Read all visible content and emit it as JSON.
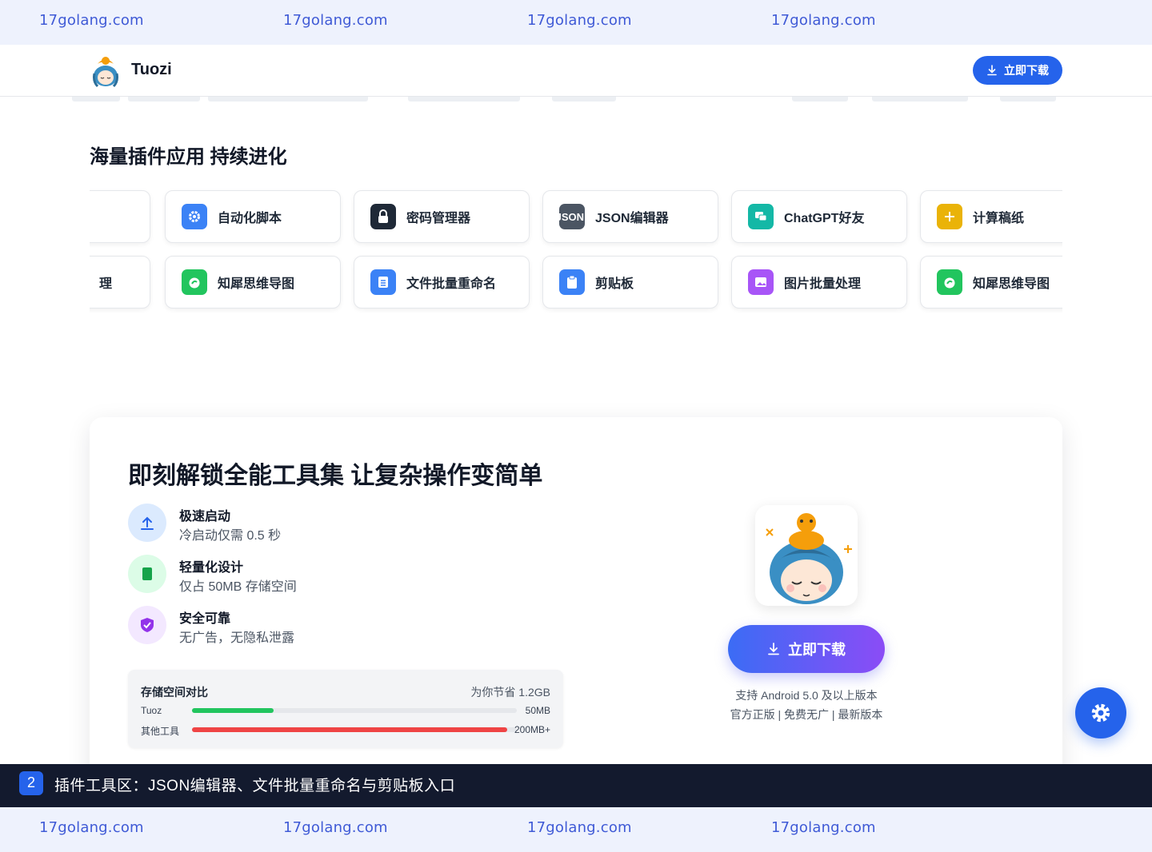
{
  "watermark": {
    "text": "17golang.com"
  },
  "header": {
    "brand": "Tuozi",
    "download_label": "立即下载"
  },
  "plugins": {
    "title": "海量插件应用 持续进化",
    "row1": [
      {
        "label": "",
        "icon": "blank-icon",
        "color": "#ffffff"
      },
      {
        "label": "自动化脚本",
        "icon": "gear-icon",
        "color": "#3b82f6"
      },
      {
        "label": "密码管理器",
        "icon": "lock-icon",
        "color": "#1f2937"
      },
      {
        "label": "JSON编辑器",
        "icon": "json-icon",
        "icon_text": "JSON",
        "color": "#4b5563"
      },
      {
        "label": "ChatGPT好友",
        "icon": "chat-icon",
        "color": "#14b8a6"
      },
      {
        "label": "计算稿纸",
        "icon": "plus-icon",
        "color": "#eab308"
      }
    ],
    "row2": [
      {
        "label": "理",
        "icon": "blank-icon",
        "color": "#ffffff"
      },
      {
        "label": "知犀思维导图",
        "icon": "mindmap-icon",
        "color": "#22c55e"
      },
      {
        "label": "文件批量重命名",
        "icon": "file-list-icon",
        "color": "#3b82f6"
      },
      {
        "label": "剪贴板",
        "icon": "clipboard-icon",
        "color": "#3b82f6"
      },
      {
        "label": "图片批量处理",
        "icon": "image-icon",
        "color": "#a855f7"
      },
      {
        "label": "知犀思维导图",
        "icon": "mindmap-icon",
        "color": "#22c55e"
      }
    ]
  },
  "main": {
    "title": "即刻解锁全能工具集 让复杂操作变简单",
    "features": [
      {
        "title": "极速启动",
        "desc": "冷启动仅需 0.5 秒",
        "icon": "upload-arrow-icon",
        "color": "#2563eb",
        "bg": "#dbeafe"
      },
      {
        "title": "轻量化设计",
        "desc": "仅占 50MB 存储空间",
        "icon": "phone-icon",
        "color": "#16a34a",
        "bg": "#dcfce7"
      },
      {
        "title": "安全可靠",
        "desc": "无广告，无隐私泄露",
        "icon": "shield-check-icon",
        "color": "#9333ea",
        "bg": "#f3e8ff"
      }
    ],
    "storage": {
      "title": "存储空间对比",
      "saving": "为你节省 1.2GB",
      "rows": [
        {
          "name": "Tuoz",
          "value": "50MB",
          "fraction": 0.25,
          "color": "#22c55e"
        },
        {
          "name": "其他工具",
          "value": "200MB+",
          "fraction": 0.97,
          "color": "#ef4444"
        }
      ]
    },
    "download_label": "立即下载",
    "support_line1": "支持 Android 5.0 及以上版本",
    "support_line2": "官方正版 | 免费无广 | 最新版本"
  },
  "caption": {
    "number": "2",
    "text": "插件工具区：JSON编辑器、文件批量重命名与剪贴板入口"
  }
}
